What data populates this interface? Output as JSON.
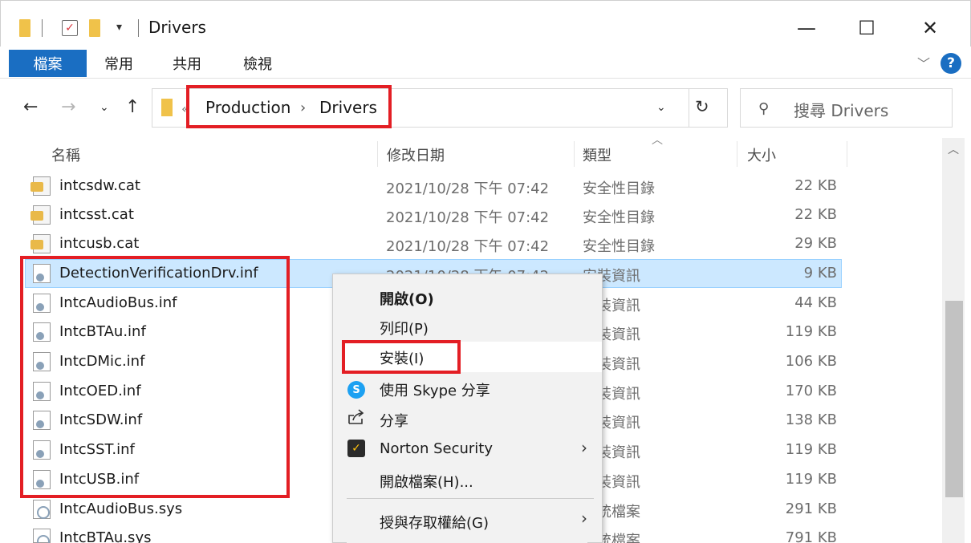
{
  "window": {
    "title": "Drivers",
    "minimize_icon": "—",
    "maximize_icon": "☐",
    "close_icon": "✕"
  },
  "ribbon": {
    "tabs": [
      {
        "label": "檔案",
        "active": true
      },
      {
        "label": "常用"
      },
      {
        "label": "共用"
      },
      {
        "label": "檢視"
      }
    ],
    "help_label": "?"
  },
  "navigation": {
    "breadcrumb_overflow": "«",
    "breadcrumb": [
      "Production",
      "Drivers"
    ],
    "breadcrumb_separator": "›",
    "search_placeholder": "搜尋 Drivers"
  },
  "columns": {
    "name": "名稱",
    "date": "修改日期",
    "type": "類型",
    "size": "大小"
  },
  "files": [
    {
      "name": "intcsdw.cat",
      "date": "2021/10/28 下午 07:42",
      "type": "安全性目錄",
      "size": "22 KB",
      "icon": "catalog-file-icon"
    },
    {
      "name": "intcsst.cat",
      "date": "2021/10/28 下午 07:42",
      "type": "安全性目錄",
      "size": "22 KB",
      "icon": "catalog-file-icon"
    },
    {
      "name": "intcusb.cat",
      "date": "2021/10/28 下午 07:42",
      "type": "安全性目錄",
      "size": "29 KB",
      "icon": "catalog-file-icon"
    },
    {
      "name": "DetectionVerificationDrv.inf",
      "date": "2021/10/28 下午 07:42",
      "type": "安裝資訊",
      "size": "9 KB",
      "icon": "setup-info-icon",
      "selected": true
    },
    {
      "name": "IntcAudioBus.inf",
      "date": "",
      "type": "裝資訊",
      "size": "44 KB",
      "icon": "setup-info-icon"
    },
    {
      "name": "IntcBTAu.inf",
      "date": "",
      "type": "裝資訊",
      "size": "119 KB",
      "icon": "setup-info-icon"
    },
    {
      "name": "IntcDMic.inf",
      "date": "",
      "type": "裝資訊",
      "size": "106 KB",
      "icon": "setup-info-icon"
    },
    {
      "name": "IntcOED.inf",
      "date": "",
      "type": "裝資訊",
      "size": "170 KB",
      "icon": "setup-info-icon"
    },
    {
      "name": "IntcSDW.inf",
      "date": "",
      "type": "裝資訊",
      "size": "138 KB",
      "icon": "setup-info-icon"
    },
    {
      "name": "IntcSST.inf",
      "date": "",
      "type": "裝資訊",
      "size": "119 KB",
      "icon": "setup-info-icon"
    },
    {
      "name": "IntcUSB.inf",
      "date": "",
      "type": "裝資訊",
      "size": "119 KB",
      "icon": "setup-info-icon"
    },
    {
      "name": "IntcAudioBus.sys",
      "date": "",
      "type": "統檔案",
      "size": "291 KB",
      "icon": "system-file-icon"
    },
    {
      "name": "IntcBTAu.sys",
      "date": "",
      "type": "統檔案",
      "size": "791 KB",
      "icon": "system-file-icon"
    }
  ],
  "context_menu": {
    "items": [
      {
        "label": "開啟(O)",
        "bold": true
      },
      {
        "label": "列印(P)"
      },
      {
        "label": "安裝(I)",
        "highlighted": true
      },
      {
        "label": "使用 Skype 分享",
        "icon": "skype-icon"
      },
      {
        "label": "分享",
        "icon": "share-icon"
      },
      {
        "label": "Norton Security",
        "icon": "norton-icon",
        "submenu": true
      },
      {
        "label": "開啟檔案(H)..."
      },
      {
        "label": "授與存取權給(G)",
        "submenu": true
      }
    ]
  },
  "colors": {
    "accent": "#1a6ec2",
    "selection": "#cce8ff",
    "callout_red": "#e31e24",
    "folder": "#f0c24a"
  }
}
